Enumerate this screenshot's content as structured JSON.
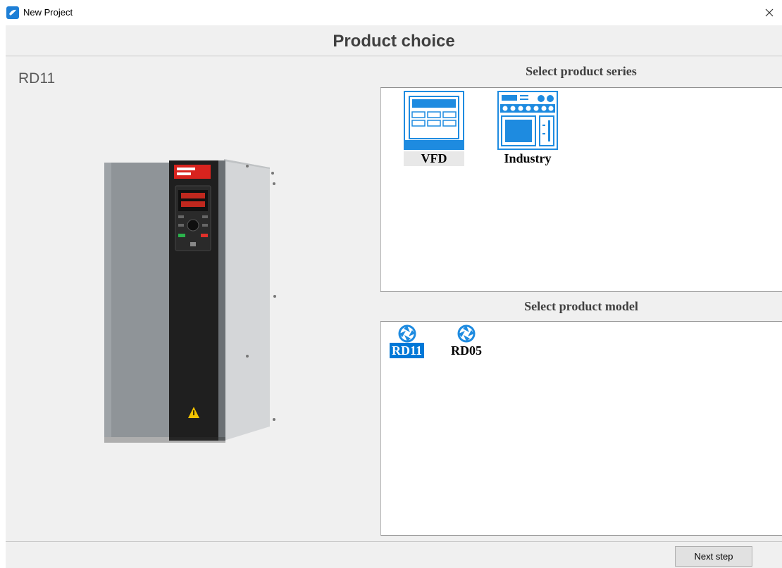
{
  "window": {
    "title": "New Project",
    "close_icon": "close-icon",
    "app_icon": "app-logo-icon"
  },
  "header": {
    "title": "Product choice"
  },
  "left_panel": {
    "selected_product": "RD11",
    "image": "vfd-drive-image"
  },
  "series": {
    "title": "Select product series",
    "items": [
      {
        "label": "VFD",
        "icon": "vfd-panel-icon",
        "selected": true
      },
      {
        "label": "Industry",
        "icon": "industry-panel-icon",
        "selected": false
      }
    ]
  },
  "models": {
    "title": "Select product model",
    "items": [
      {
        "label": "RD11",
        "icon": "aperture-icon",
        "selected": true
      },
      {
        "label": "RD05",
        "icon": "aperture-icon",
        "selected": false
      }
    ]
  },
  "footer": {
    "next_label": "Next step"
  },
  "colors": {
    "accent": "#0078d7",
    "icon_blue": "#1e8be0",
    "background": "#f0f0f0"
  }
}
